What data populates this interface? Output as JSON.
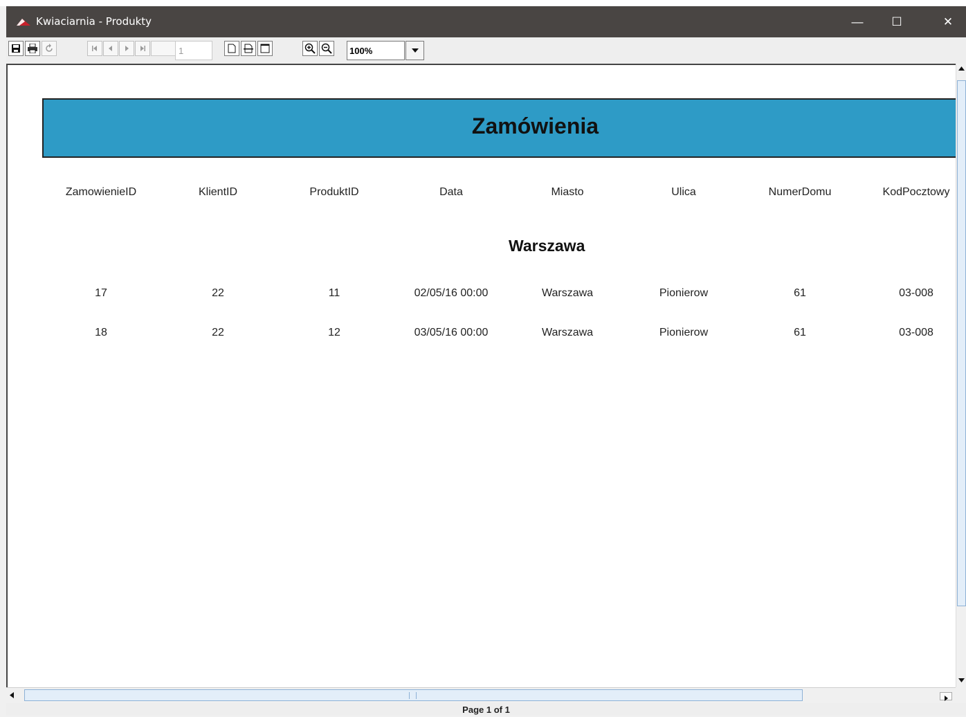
{
  "window": {
    "title": "Kwiaciarnia - Produkty",
    "controls": {
      "minimize": "—",
      "maximize": "☐",
      "close": "✕"
    },
    "colors": {
      "titlebar": "#494543",
      "accent": "#2e9bc6"
    }
  },
  "toolbar": {
    "icons": [
      "save-icon",
      "print-icon",
      "reload-icon",
      "first-page-icon",
      "previous-page-icon",
      "next-page-icon",
      "last-page-icon",
      "actual-size-icon",
      "fit-width-icon",
      "fit-page-icon",
      "zoom-in-icon",
      "zoom-out-icon",
      "dropdown-arrow-icon"
    ],
    "page_number": "1",
    "zoom": "100%"
  },
  "report": {
    "title": "Zamówienia",
    "columns": [
      "ZamowienieID",
      "KlientID",
      "ProduktID",
      "Data",
      "Miasto",
      "Ulica",
      "NumerDomu",
      "KodPocztowy"
    ],
    "group": "Warszawa",
    "rows": [
      [
        "17",
        "22",
        "11",
        "02/05/16 00:00",
        "Warszawa",
        "Pionierow",
        "61",
        "03-008"
      ],
      [
        "18",
        "22",
        "12",
        "03/05/16 00:00",
        "Warszawa",
        "Pionierow",
        "61",
        "03-008"
      ]
    ]
  },
  "status": {
    "page_label": "Page 1 of 1"
  }
}
